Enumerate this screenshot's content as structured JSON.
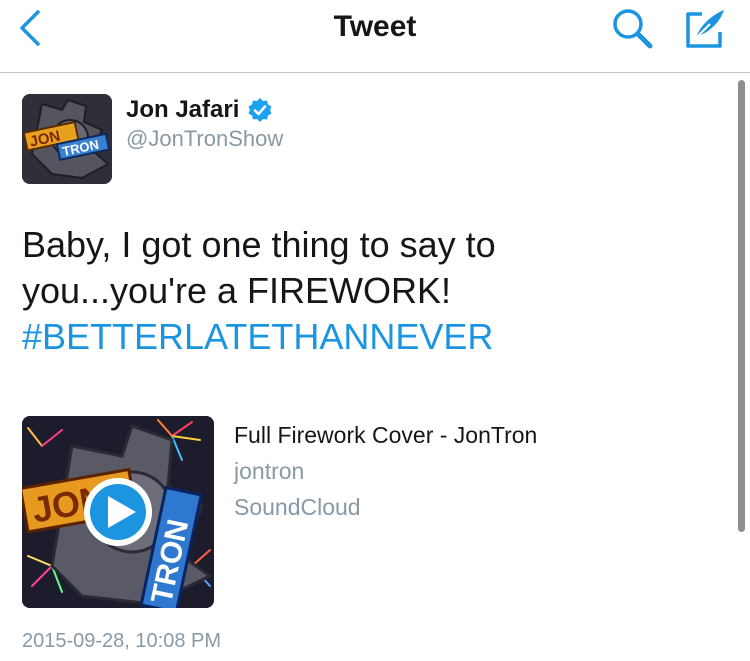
{
  "nav": {
    "title": "Tweet",
    "back_icon": "chevron-left-icon",
    "search_icon": "search-icon",
    "compose_icon": "compose-icon",
    "accent_color": "#1b95e0"
  },
  "tweet": {
    "author": {
      "name": "Jon Jafari",
      "handle": "@JonTronShow",
      "verified": true,
      "avatar_logo_text": "JON TRON"
    },
    "text_lines": [
      "Baby, I got one thing to say to",
      "you...you're a FIREWORK!"
    ],
    "hashtag": "#BETTERLATETHANNEVER",
    "card": {
      "title": "Full Firework Cover - JonTron",
      "author": "jontron",
      "source": "SoundCloud",
      "thumb_logo_text": "JON TRON",
      "play_icon": "play-icon"
    },
    "timestamp": "2015-09-28, 10:08 PM"
  }
}
